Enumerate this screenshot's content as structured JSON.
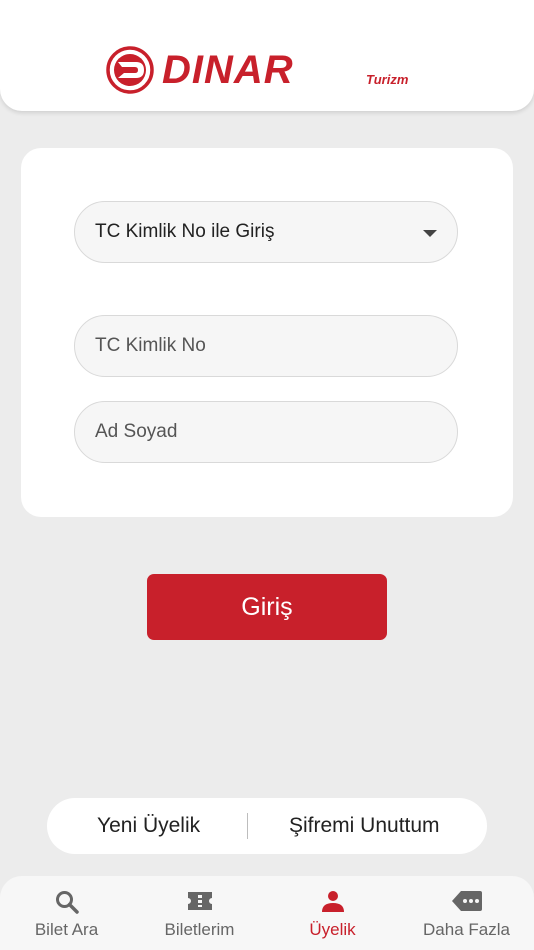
{
  "brand": {
    "name": "DINAR",
    "sub": "Turizm",
    "color": "#c8202b"
  },
  "form": {
    "login_type": "TC Kimlik No ile Giriş",
    "tc_placeholder": "TC Kimlik No",
    "name_placeholder": "Ad Soyad"
  },
  "login_button": "Giriş",
  "links": {
    "new_member": "Yeni Üyelik",
    "forgot_password": "Şifremi Unuttum"
  },
  "tabs": [
    {
      "label": "Bilet Ara",
      "icon": "search-icon",
      "active": false
    },
    {
      "label": "Biletlerim",
      "icon": "ticket-icon",
      "active": false
    },
    {
      "label": "Üyelik",
      "icon": "person-icon",
      "active": true
    },
    {
      "label": "Daha Fazla",
      "icon": "more-tag-icon",
      "active": false
    }
  ]
}
